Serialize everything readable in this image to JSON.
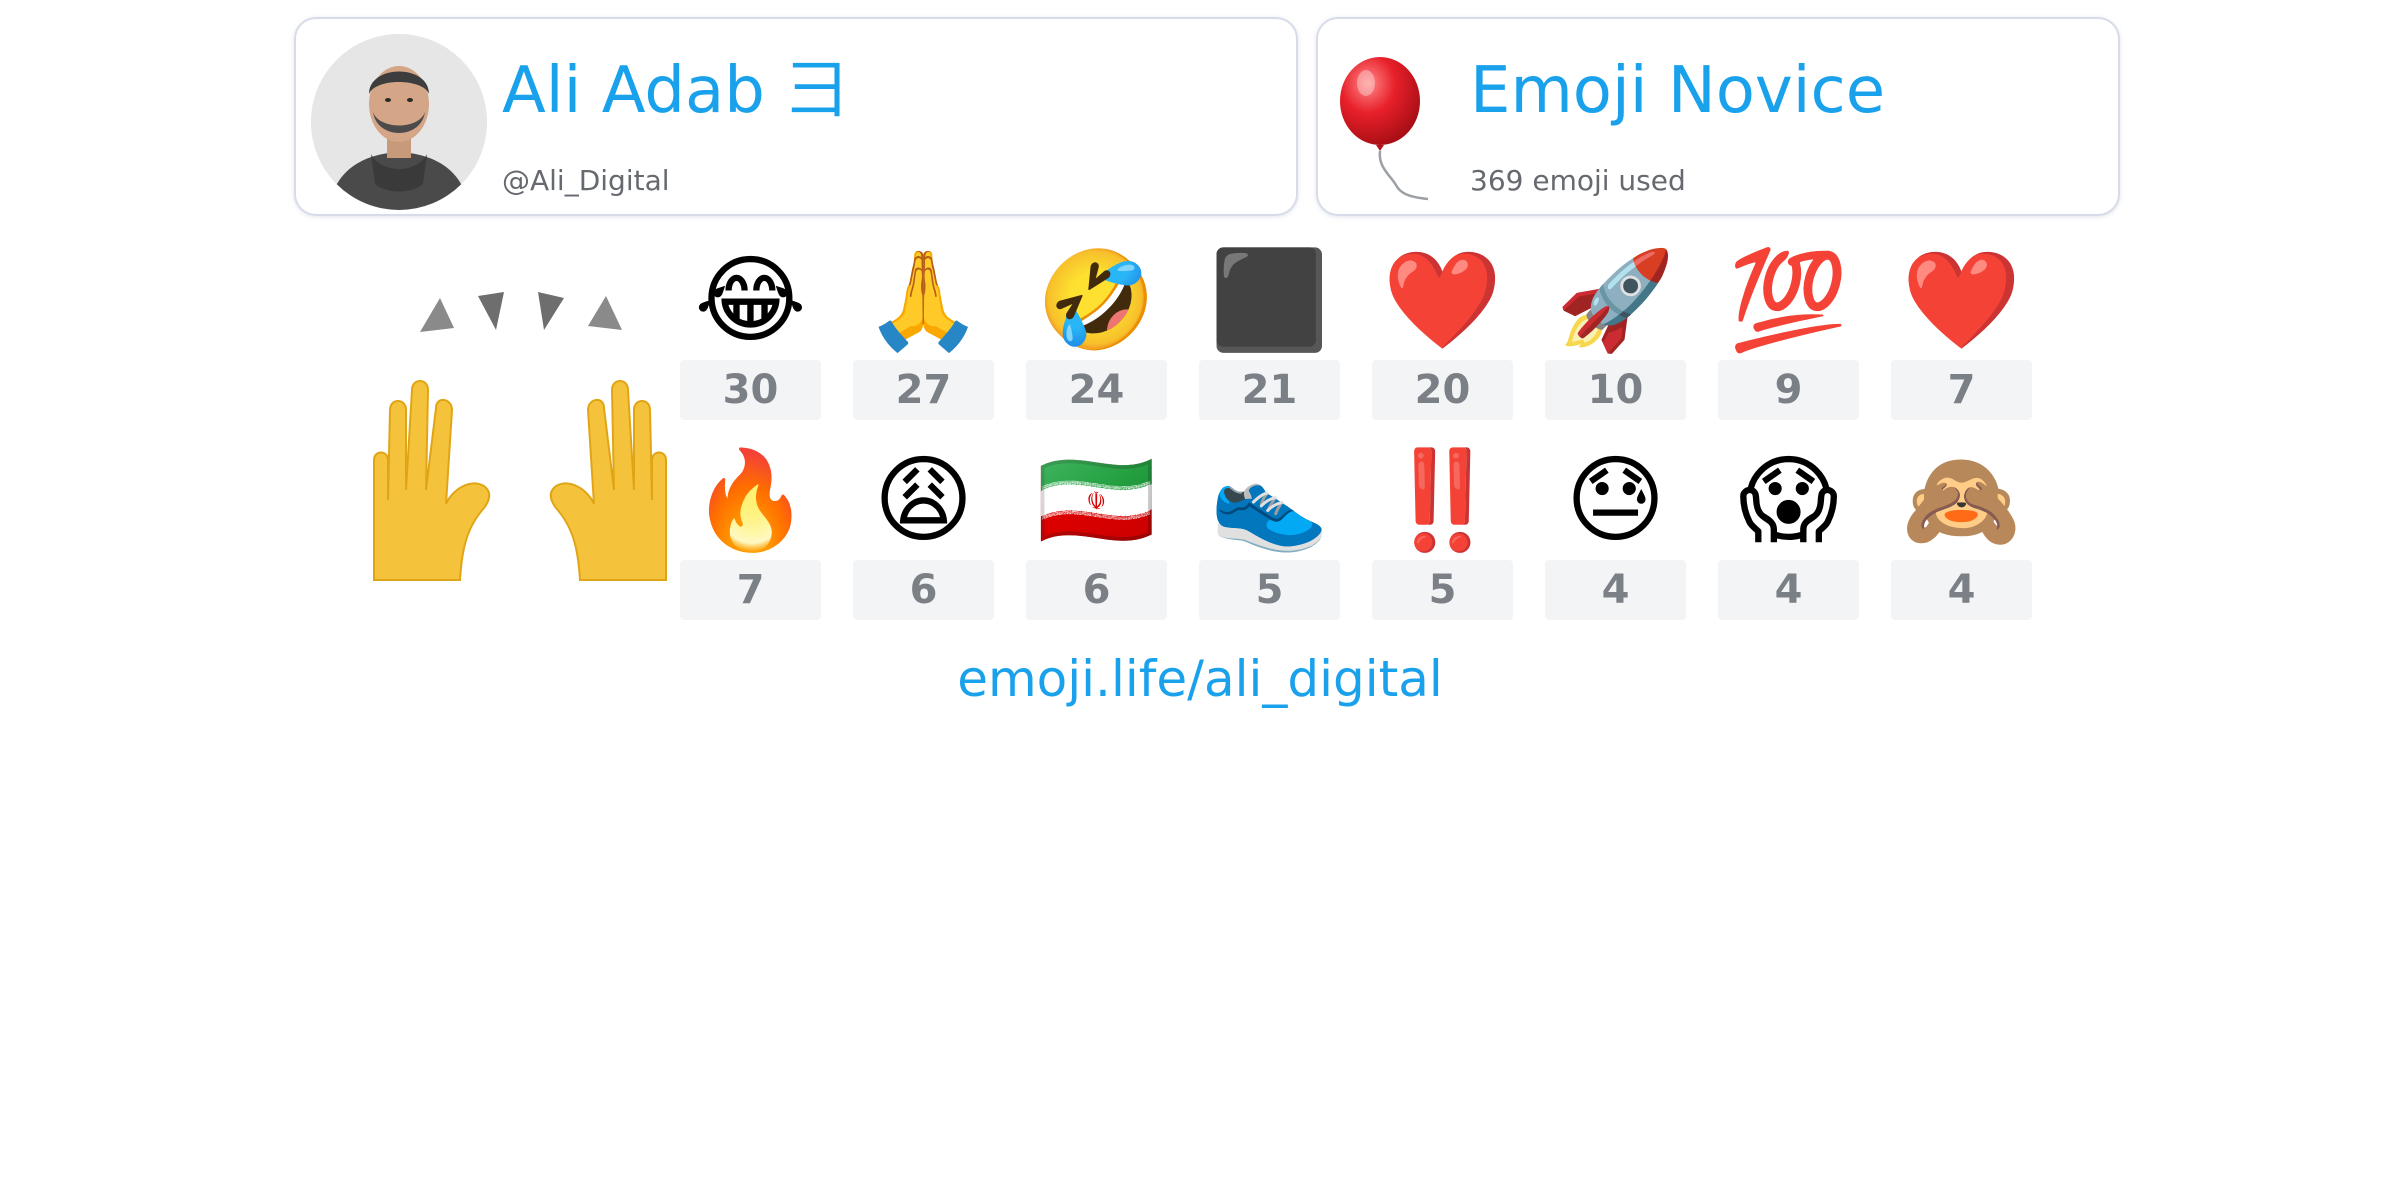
{
  "profile": {
    "name": "Ali Adab ⺕",
    "handle": "@Ali_Digital"
  },
  "stats": {
    "title": "Emoji Novice",
    "used": "369 emoji used",
    "title_icon": "balloon-icon"
  },
  "featured_emoji": "🙌",
  "top_emoji": [
    {
      "emoji": "😂",
      "count": "30"
    },
    {
      "emoji": "🙏",
      "count": "27"
    },
    {
      "emoji": "🤣",
      "count": "24"
    },
    {
      "emoji": "⬛",
      "count": "21"
    },
    {
      "emoji": "❤️",
      "count": "20"
    },
    {
      "emoji": "🚀",
      "count": "10"
    },
    {
      "emoji": "💯",
      "count": "9"
    },
    {
      "emoji": "❤️",
      "count": "7"
    },
    {
      "emoji": "🔥",
      "count": "7"
    },
    {
      "emoji": "😩",
      "count": "6"
    },
    {
      "emoji": "🇮🇷",
      "count": "6"
    },
    {
      "emoji": "👟",
      "count": "5"
    },
    {
      "emoji": "‼️",
      "count": "5"
    },
    {
      "emoji": "😓",
      "count": "4"
    },
    {
      "emoji": "😱",
      "count": "4"
    },
    {
      "emoji": "🙈",
      "count": "4"
    }
  ],
  "footer": {
    "link": "emoji.life/ali_digital"
  },
  "colors": {
    "accent": "#1aa1ec",
    "muted_text": "#666a70",
    "count_bg": "#f3f4f6",
    "count_text": "#7b7f86",
    "card_border": "#d7dce8"
  }
}
